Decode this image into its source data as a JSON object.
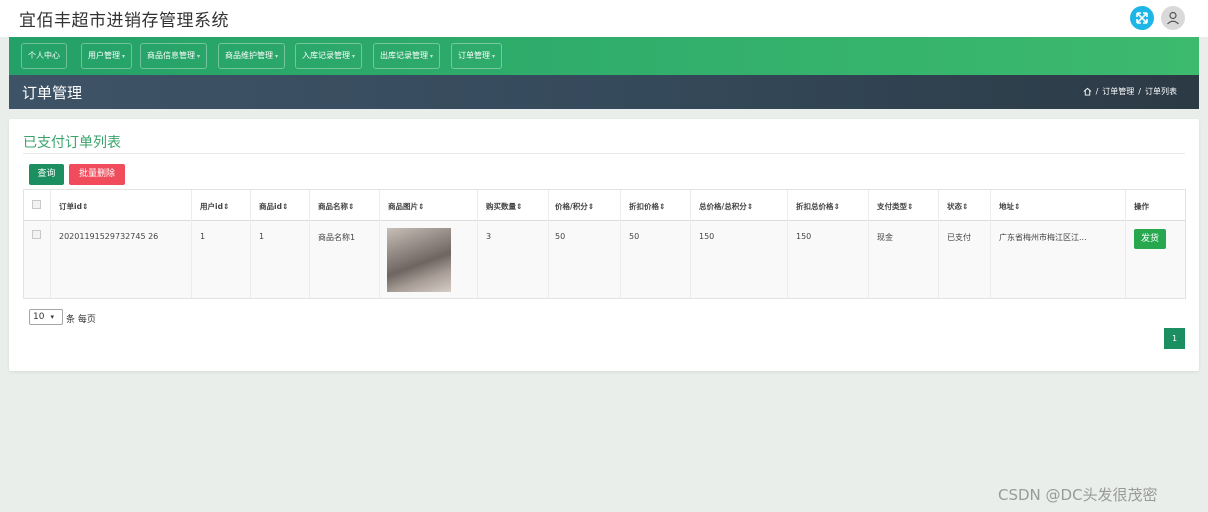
{
  "app": {
    "title": "宜佰丰超市进销存管理系统"
  },
  "header_icons": {
    "fullscreen": "expand-icon",
    "user": "user-icon"
  },
  "nav": {
    "items": [
      {
        "label": "个人中心"
      },
      {
        "label": "用户管理"
      },
      {
        "label": "商品信息管理"
      },
      {
        "label": "商品维护管理"
      },
      {
        "label": "入库记录管理"
      },
      {
        "label": "出库记录管理"
      },
      {
        "label": "订单管理"
      }
    ]
  },
  "page": {
    "title": "订单管理",
    "breadcrumb": {
      "home_icon": "home-icon",
      "sep": "/",
      "level1": "订单管理",
      "level2": "订单列表"
    }
  },
  "card": {
    "title": "已支付订单列表",
    "query_button": "查询",
    "delete_button": "批量删除"
  },
  "table": {
    "columns": [
      "订单id",
      "用户id",
      "商品id",
      "商品名称",
      "商品图片",
      "购买数量",
      "价格/积分",
      "折扣价格",
      "总价格/总积分",
      "折扣总价格",
      "支付类型",
      "状态",
      "地址",
      "操作"
    ],
    "sort_icon": "⇕",
    "rows": [
      {
        "order_id": "20201191529732745 26",
        "user_id": "1",
        "product_id": "1",
        "product_name": "商品名称1",
        "quantity": "3",
        "price": "50",
        "discount_price": "50",
        "total": "150",
        "discount_total": "150",
        "pay_type": "现金",
        "status": "已支付",
        "address": "广东省梅州市梅江区江...",
        "action": "发货"
      }
    ]
  },
  "pagination": {
    "page_size": "10",
    "page_size_label": "条 每页",
    "current_page": "1"
  },
  "watermark": "CSDN @DC头发很茂密",
  "colors": {
    "nav_green": "#24a168",
    "title_green": "#3aa36a",
    "delete_red": "#f04c5c",
    "ship_green": "#27a84f"
  }
}
